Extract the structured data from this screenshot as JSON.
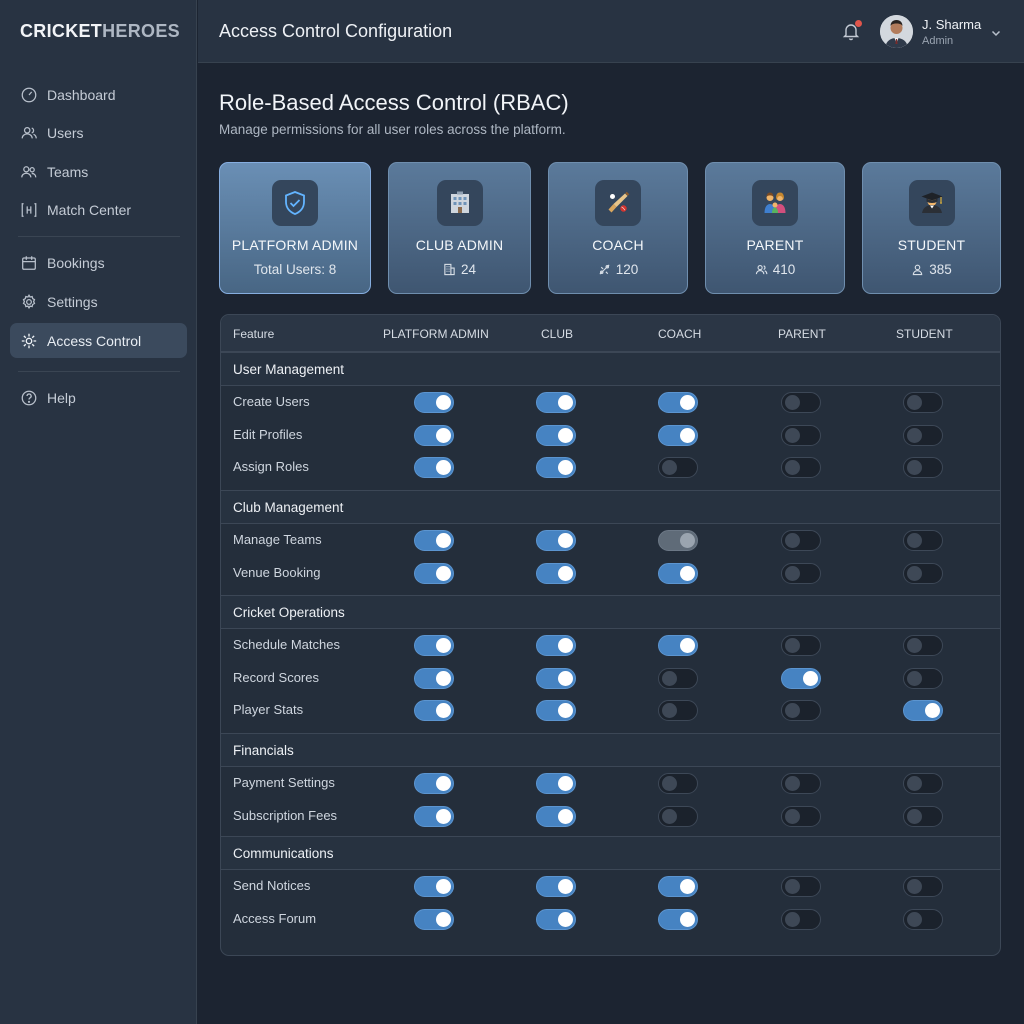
{
  "app": {
    "logo_part1": "CRICKET",
    "logo_part2": "HEROES"
  },
  "sidebar": {
    "items": [
      {
        "label": "Dashboard",
        "icon": "gauge-icon"
      },
      {
        "label": "Users",
        "icon": "users-icon"
      },
      {
        "label": "Teams",
        "icon": "team-icon"
      },
      {
        "label": "Match Center",
        "icon": "match-center-icon"
      },
      {
        "label": "Bookings",
        "icon": "calendar-icon"
      },
      {
        "label": "Settings",
        "icon": "gear-icon"
      },
      {
        "label": "Access Control",
        "icon": "sun-icon",
        "active": true
      },
      {
        "label": "Help",
        "icon": "help-icon"
      }
    ]
  },
  "header": {
    "title": "Access Control Configuration",
    "user_name": "J. Sharma",
    "user_role": "Admin"
  },
  "page": {
    "title": "Role-Based Access Control (RBAC)",
    "subtitle": "Manage permissions for all user roles across the platform."
  },
  "roles": [
    {
      "name": "PLATFORM ADMIN",
      "count": "Total Users: 8",
      "icon": "shield-icon",
      "active": true
    },
    {
      "name": "CLUB ADMIN",
      "count": "24",
      "icon": "building-icon"
    },
    {
      "name": "COACH",
      "count": "120",
      "icon": "cricket-bat-icon"
    },
    {
      "name": "PARENT",
      "count": "410",
      "icon": "family-icon"
    },
    {
      "name": "STUDENT",
      "count": "385",
      "icon": "graduate-icon"
    }
  ],
  "table": {
    "headers": [
      "Feature",
      "PLATFORM ADMIN",
      "CLUB",
      "COACH",
      "PARENT",
      "STUDENT"
    ],
    "groups": [
      {
        "name": "User Management",
        "rows": [
          {
            "feature": "Create Users",
            "perms": [
              "on",
              "on",
              "on",
              "off",
              "off"
            ]
          },
          {
            "feature": "Edit Profiles",
            "perms": [
              "on",
              "on",
              "on",
              "off",
              "off"
            ]
          },
          {
            "feature": "Assign Roles",
            "perms": [
              "on",
              "on",
              "off",
              "off",
              "off"
            ]
          }
        ]
      },
      {
        "name": "Club Management",
        "rows": [
          {
            "feature": "Manage Teams",
            "perms": [
              "on",
              "on",
              "partial",
              "off",
              "off"
            ]
          },
          {
            "feature": "Venue Booking",
            "perms": [
              "on",
              "on",
              "on",
              "off",
              "off"
            ]
          }
        ]
      },
      {
        "name": "Cricket Operations",
        "rows": [
          {
            "feature": "Schedule Matches",
            "perms": [
              "on",
              "on",
              "on",
              "off",
              "off"
            ]
          },
          {
            "feature": "Record Scores",
            "perms": [
              "on",
              "on",
              "off",
              "on",
              "off"
            ]
          },
          {
            "feature": "Player Stats",
            "perms": [
              "on",
              "on",
              "off",
              "off",
              "on"
            ]
          }
        ]
      },
      {
        "name": "Financials",
        "rows": [
          {
            "feature": "Payment Settings",
            "perms": [
              "on",
              "on",
              "off",
              "off",
              "off"
            ]
          },
          {
            "feature": "Subscription Fees",
            "perms": [
              "on",
              "on",
              "off",
              "off",
              "off"
            ]
          }
        ]
      },
      {
        "name": "Communications",
        "rows": [
          {
            "feature": "Send Notices",
            "perms": [
              "on",
              "on",
              "on",
              "off",
              "off"
            ]
          },
          {
            "feature": "Access Forum",
            "perms": [
              "on",
              "on",
              "on",
              "off",
              "off"
            ]
          }
        ]
      }
    ]
  },
  "colors": {
    "toggle_on": "#4683c2",
    "accent_card": "#5b7a9b",
    "notification": "#e0554b"
  }
}
